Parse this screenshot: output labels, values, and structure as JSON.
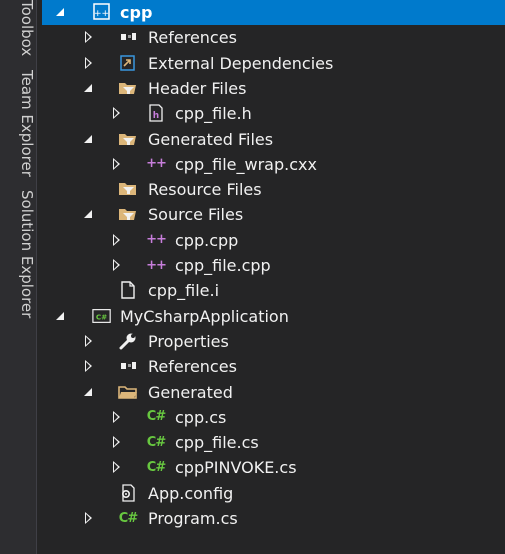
{
  "side_tabs": [
    "Toolbox",
    "Team Explorer",
    "Solution Explorer"
  ],
  "tree": [
    {
      "label": "cpp",
      "icon": "cpp-project-icon",
      "indent": 0,
      "state": "expanded",
      "selected": true
    },
    {
      "label": "References",
      "icon": "references-icon",
      "indent": 1,
      "state": "collapsed"
    },
    {
      "label": "External Dependencies",
      "icon": "external-dependencies-icon",
      "indent": 1,
      "state": "collapsed"
    },
    {
      "label": "Header Files",
      "icon": "filter-folder-open-icon",
      "indent": 1,
      "state": "expanded"
    },
    {
      "label": "cpp_file.h",
      "icon": "header-file-icon",
      "indent": 2,
      "state": "collapsed"
    },
    {
      "label": "Generated Files",
      "icon": "filter-folder-open-icon",
      "indent": 1,
      "state": "expanded"
    },
    {
      "label": "cpp_file_wrap.cxx",
      "icon": "cpp-file-icon",
      "indent": 2,
      "state": "collapsed"
    },
    {
      "label": "Resource Files",
      "icon": "filter-folder-icon",
      "indent": 1,
      "state": "none"
    },
    {
      "label": "Source Files",
      "icon": "filter-folder-open-icon",
      "indent": 1,
      "state": "expanded"
    },
    {
      "label": "cpp.cpp",
      "icon": "cpp-file-icon",
      "indent": 2,
      "state": "collapsed"
    },
    {
      "label": "cpp_file.cpp",
      "icon": "cpp-file-icon",
      "indent": 2,
      "state": "collapsed"
    },
    {
      "label": "cpp_file.i",
      "icon": "file-icon",
      "indent": 1,
      "state": "none"
    },
    {
      "label": "MyCsharpApplication",
      "icon": "csharp-project-icon",
      "indent": 0,
      "state": "expanded"
    },
    {
      "label": "Properties",
      "icon": "wrench-icon",
      "indent": 1,
      "state": "collapsed"
    },
    {
      "label": "References",
      "icon": "references-icon",
      "indent": 1,
      "state": "collapsed"
    },
    {
      "label": "Generated",
      "icon": "folder-open-icon",
      "indent": 1,
      "state": "expanded"
    },
    {
      "label": "cpp.cs",
      "icon": "csharp-file-icon",
      "indent": 2,
      "state": "collapsed"
    },
    {
      "label": "cpp_file.cs",
      "icon": "csharp-file-icon",
      "indent": 2,
      "state": "collapsed"
    },
    {
      "label": "cppPINVOKE.cs",
      "icon": "csharp-file-icon",
      "indent": 2,
      "state": "collapsed"
    },
    {
      "label": "App.config",
      "icon": "config-file-icon",
      "indent": 1,
      "state": "none"
    },
    {
      "label": "Program.cs",
      "icon": "csharp-file-icon",
      "indent": 1,
      "state": "collapsed"
    }
  ],
  "glyphs": {
    "cs": "C#",
    "cpp": "++"
  },
  "colors": {
    "selection": "#007acc",
    "background": "#252526",
    "text": "#f1f1f1",
    "folder": "#dcb67a",
    "csharp": "#68c840",
    "cpp": "#c77edb"
  }
}
